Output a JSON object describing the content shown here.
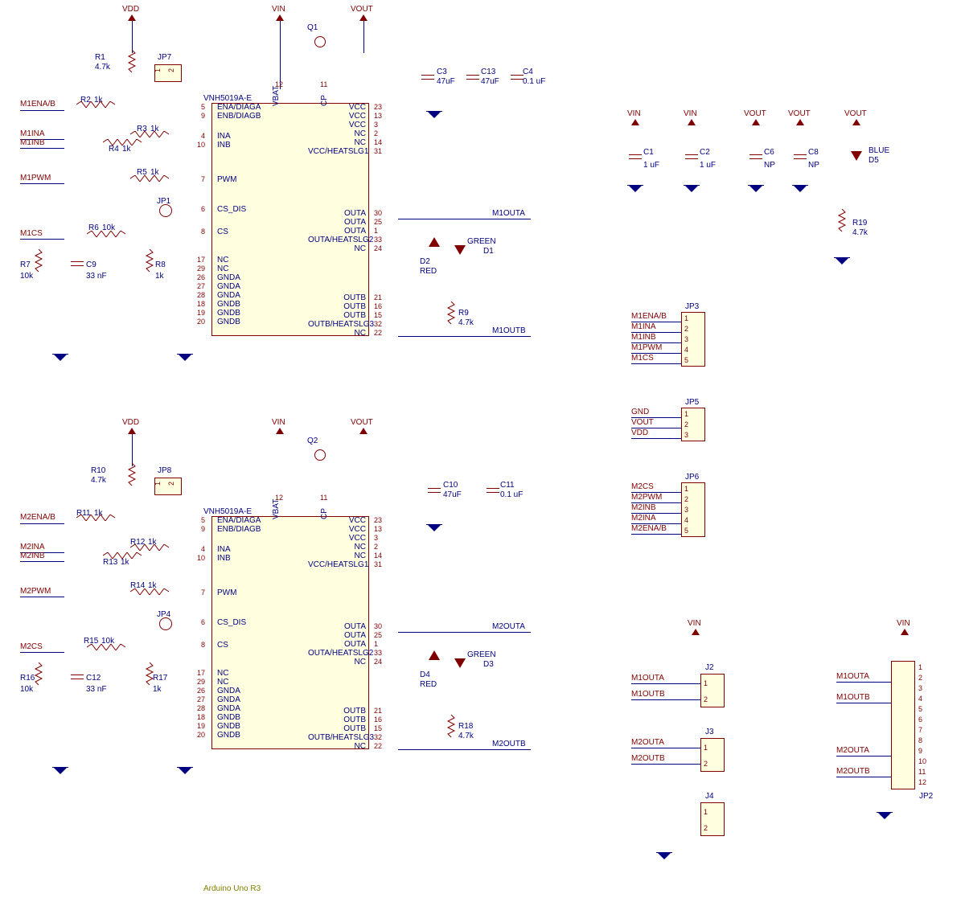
{
  "ic_name": "VNH5019A-E",
  "footer": "Arduino Uno R3",
  "channel1": {
    "power_rails": {
      "vdd": "VDD",
      "vin": "VIN",
      "vout": "VOUT"
    },
    "components": {
      "R1": {
        "name": "R1",
        "value": "4.7k"
      },
      "R2": {
        "name": "R2",
        "value": "1k"
      },
      "R3": {
        "name": "R3",
        "value": "1k"
      },
      "R4": {
        "name": "R4",
        "value": "1k"
      },
      "R5": {
        "name": "R5",
        "value": "1k"
      },
      "R6": {
        "name": "R6",
        "value": "10k"
      },
      "R7": {
        "name": "R7",
        "value": "10k"
      },
      "R8": {
        "name": "R8",
        "value": "1k"
      },
      "R9": {
        "name": "R9",
        "value": "4.7k"
      },
      "C3": {
        "name": "C3",
        "value": "47uF"
      },
      "C13": {
        "name": "C13",
        "value": "47uF"
      },
      "C4": {
        "name": "C4",
        "value": "0.1 uF"
      },
      "C9": {
        "name": "C9",
        "value": "33 nF"
      },
      "Q1": "Q1",
      "D1": {
        "name": "D1",
        "color": "GREEN"
      },
      "D2": {
        "name": "D2",
        "color": "RED"
      }
    },
    "jumpers": {
      "JP1": "JP1",
      "JP7": "JP7"
    },
    "nets": {
      "M1ENA_B": "M1ENA/B",
      "M1INA": "M1INA",
      "M1INB": "M1INB",
      "M1PWM": "M1PWM",
      "M1CS": "M1CS",
      "M1OUTA": "M1OUTA",
      "M1OUTB": "M1OUTB"
    },
    "pins_left": [
      {
        "num": "5",
        "name": "ENA/DIAGA"
      },
      {
        "num": "9",
        "name": "ENB/DIAGB"
      },
      {
        "num": "4",
        "name": "INA"
      },
      {
        "num": "10",
        "name": "INB"
      },
      {
        "num": "7",
        "name": "PWM"
      },
      {
        "num": "6",
        "name": "CS_DIS"
      },
      {
        "num": "8",
        "name": "CS"
      },
      {
        "num": "17",
        "name": "NC"
      },
      {
        "num": "29",
        "name": "NC"
      },
      {
        "num": "26",
        "name": "GNDA"
      },
      {
        "num": "27",
        "name": "GNDA"
      },
      {
        "num": "28",
        "name": "GNDA"
      },
      {
        "num": "18",
        "name": "GNDB"
      },
      {
        "num": "19",
        "name": "GNDB"
      },
      {
        "num": "20",
        "name": "GNDB"
      }
    ],
    "pins_top": [
      {
        "num": "12",
        "name": "VBAT"
      },
      {
        "num": "11",
        "name": "CP"
      }
    ],
    "pins_right": [
      {
        "num": "23",
        "name": "VCC"
      },
      {
        "num": "13",
        "name": "VCC"
      },
      {
        "num": "3",
        "name": "VCC"
      },
      {
        "num": "2",
        "name": "NC"
      },
      {
        "num": "14",
        "name": "NC"
      },
      {
        "num": "31",
        "name": "VCC/HEATSLG1"
      },
      {
        "num": "30",
        "name": "OUTA"
      },
      {
        "num": "25",
        "name": "OUTA"
      },
      {
        "num": "1",
        "name": "OUTA"
      },
      {
        "num": "33",
        "name": "OUTA/HEATSLG2"
      },
      {
        "num": "24",
        "name": "NC"
      },
      {
        "num": "21",
        "name": "OUTB"
      },
      {
        "num": "16",
        "name": "OUTB"
      },
      {
        "num": "15",
        "name": "OUTB"
      },
      {
        "num": "32",
        "name": "OUTB/HEATSLG3"
      },
      {
        "num": "22",
        "name": "NC"
      }
    ]
  },
  "channel2": {
    "power_rails": {
      "vdd": "VDD",
      "vin": "VIN",
      "vout": "VOUT"
    },
    "components": {
      "R10": {
        "name": "R10",
        "value": "4.7k"
      },
      "R11": {
        "name": "R11",
        "value": "1k"
      },
      "R12": {
        "name": "R12",
        "value": "1k"
      },
      "R13": {
        "name": "R13",
        "value": "1k"
      },
      "R14": {
        "name": "R14",
        "value": "1k"
      },
      "R15": {
        "name": "R15",
        "value": "10k"
      },
      "R16": {
        "name": "R16",
        "value": "10k"
      },
      "R17": {
        "name": "R17",
        "value": "1k"
      },
      "R18": {
        "name": "R18",
        "value": "4.7k"
      },
      "C10": {
        "name": "C10",
        "value": "47uF"
      },
      "C11": {
        "name": "C11",
        "value": "0.1 uF"
      },
      "C12": {
        "name": "C12",
        "value": "33 nF"
      },
      "Q2": "Q2",
      "D3": {
        "name": "D3",
        "color": "GREEN"
      },
      "D4": {
        "name": "D4",
        "color": "RED"
      }
    },
    "jumpers": {
      "JP4": "JP4",
      "JP8": "JP8"
    },
    "nets": {
      "M2ENA_B": "M2ENA/B",
      "M2INA": "M2INA",
      "M2INB": "M2INB",
      "M2PWM": "M2PWM",
      "M2CS": "M2CS",
      "M2OUTA": "M2OUTA",
      "M2OUTB": "M2OUTB"
    }
  },
  "right_section": {
    "caps": {
      "C1": {
        "name": "C1",
        "value": "1 uF",
        "rail": "VIN"
      },
      "C2": {
        "name": "C2",
        "value": "1 uF",
        "rail": "VIN"
      },
      "C6": {
        "name": "C6",
        "value": "NP",
        "rail": "VOUT"
      },
      "C8": {
        "name": "C8",
        "value": "NP",
        "rail": "VOUT"
      }
    },
    "led": {
      "name": "D5",
      "color": "BLUE",
      "rail": "VOUT",
      "R19": {
        "name": "R19",
        "value": "4.7k"
      }
    }
  },
  "connectors": {
    "JP3": {
      "name": "JP3",
      "pins": [
        "M1ENA/B",
        "M1INA",
        "M1INB",
        "M1PWM",
        "M1CS"
      ]
    },
    "JP5": {
      "name": "JP5",
      "pins": [
        "GND",
        "VOUT",
        "VDD"
      ]
    },
    "JP6": {
      "name": "JP6",
      "pins": [
        "M2CS",
        "M2PWM",
        "M2INB",
        "M2INA",
        "M2ENA/B"
      ]
    },
    "J2": {
      "name": "J2",
      "rail": "VIN",
      "pins": [
        "M1OUTA",
        "M1OUTB"
      ]
    },
    "J3": {
      "name": "J3",
      "pins": [
        "M2OUTA",
        "M2OUTB"
      ]
    },
    "J4": {
      "name": "J4"
    },
    "JP2": {
      "name": "JP2",
      "rail": "VIN",
      "pins": [
        "M1OUTA",
        "M1OUTB",
        "M2OUTA",
        "M2OUTB"
      ]
    }
  },
  "pin_nums_sm": [
    "1",
    "2",
    "3",
    "4",
    "5",
    "6",
    "7",
    "8",
    "9",
    "10",
    "11",
    "12"
  ]
}
